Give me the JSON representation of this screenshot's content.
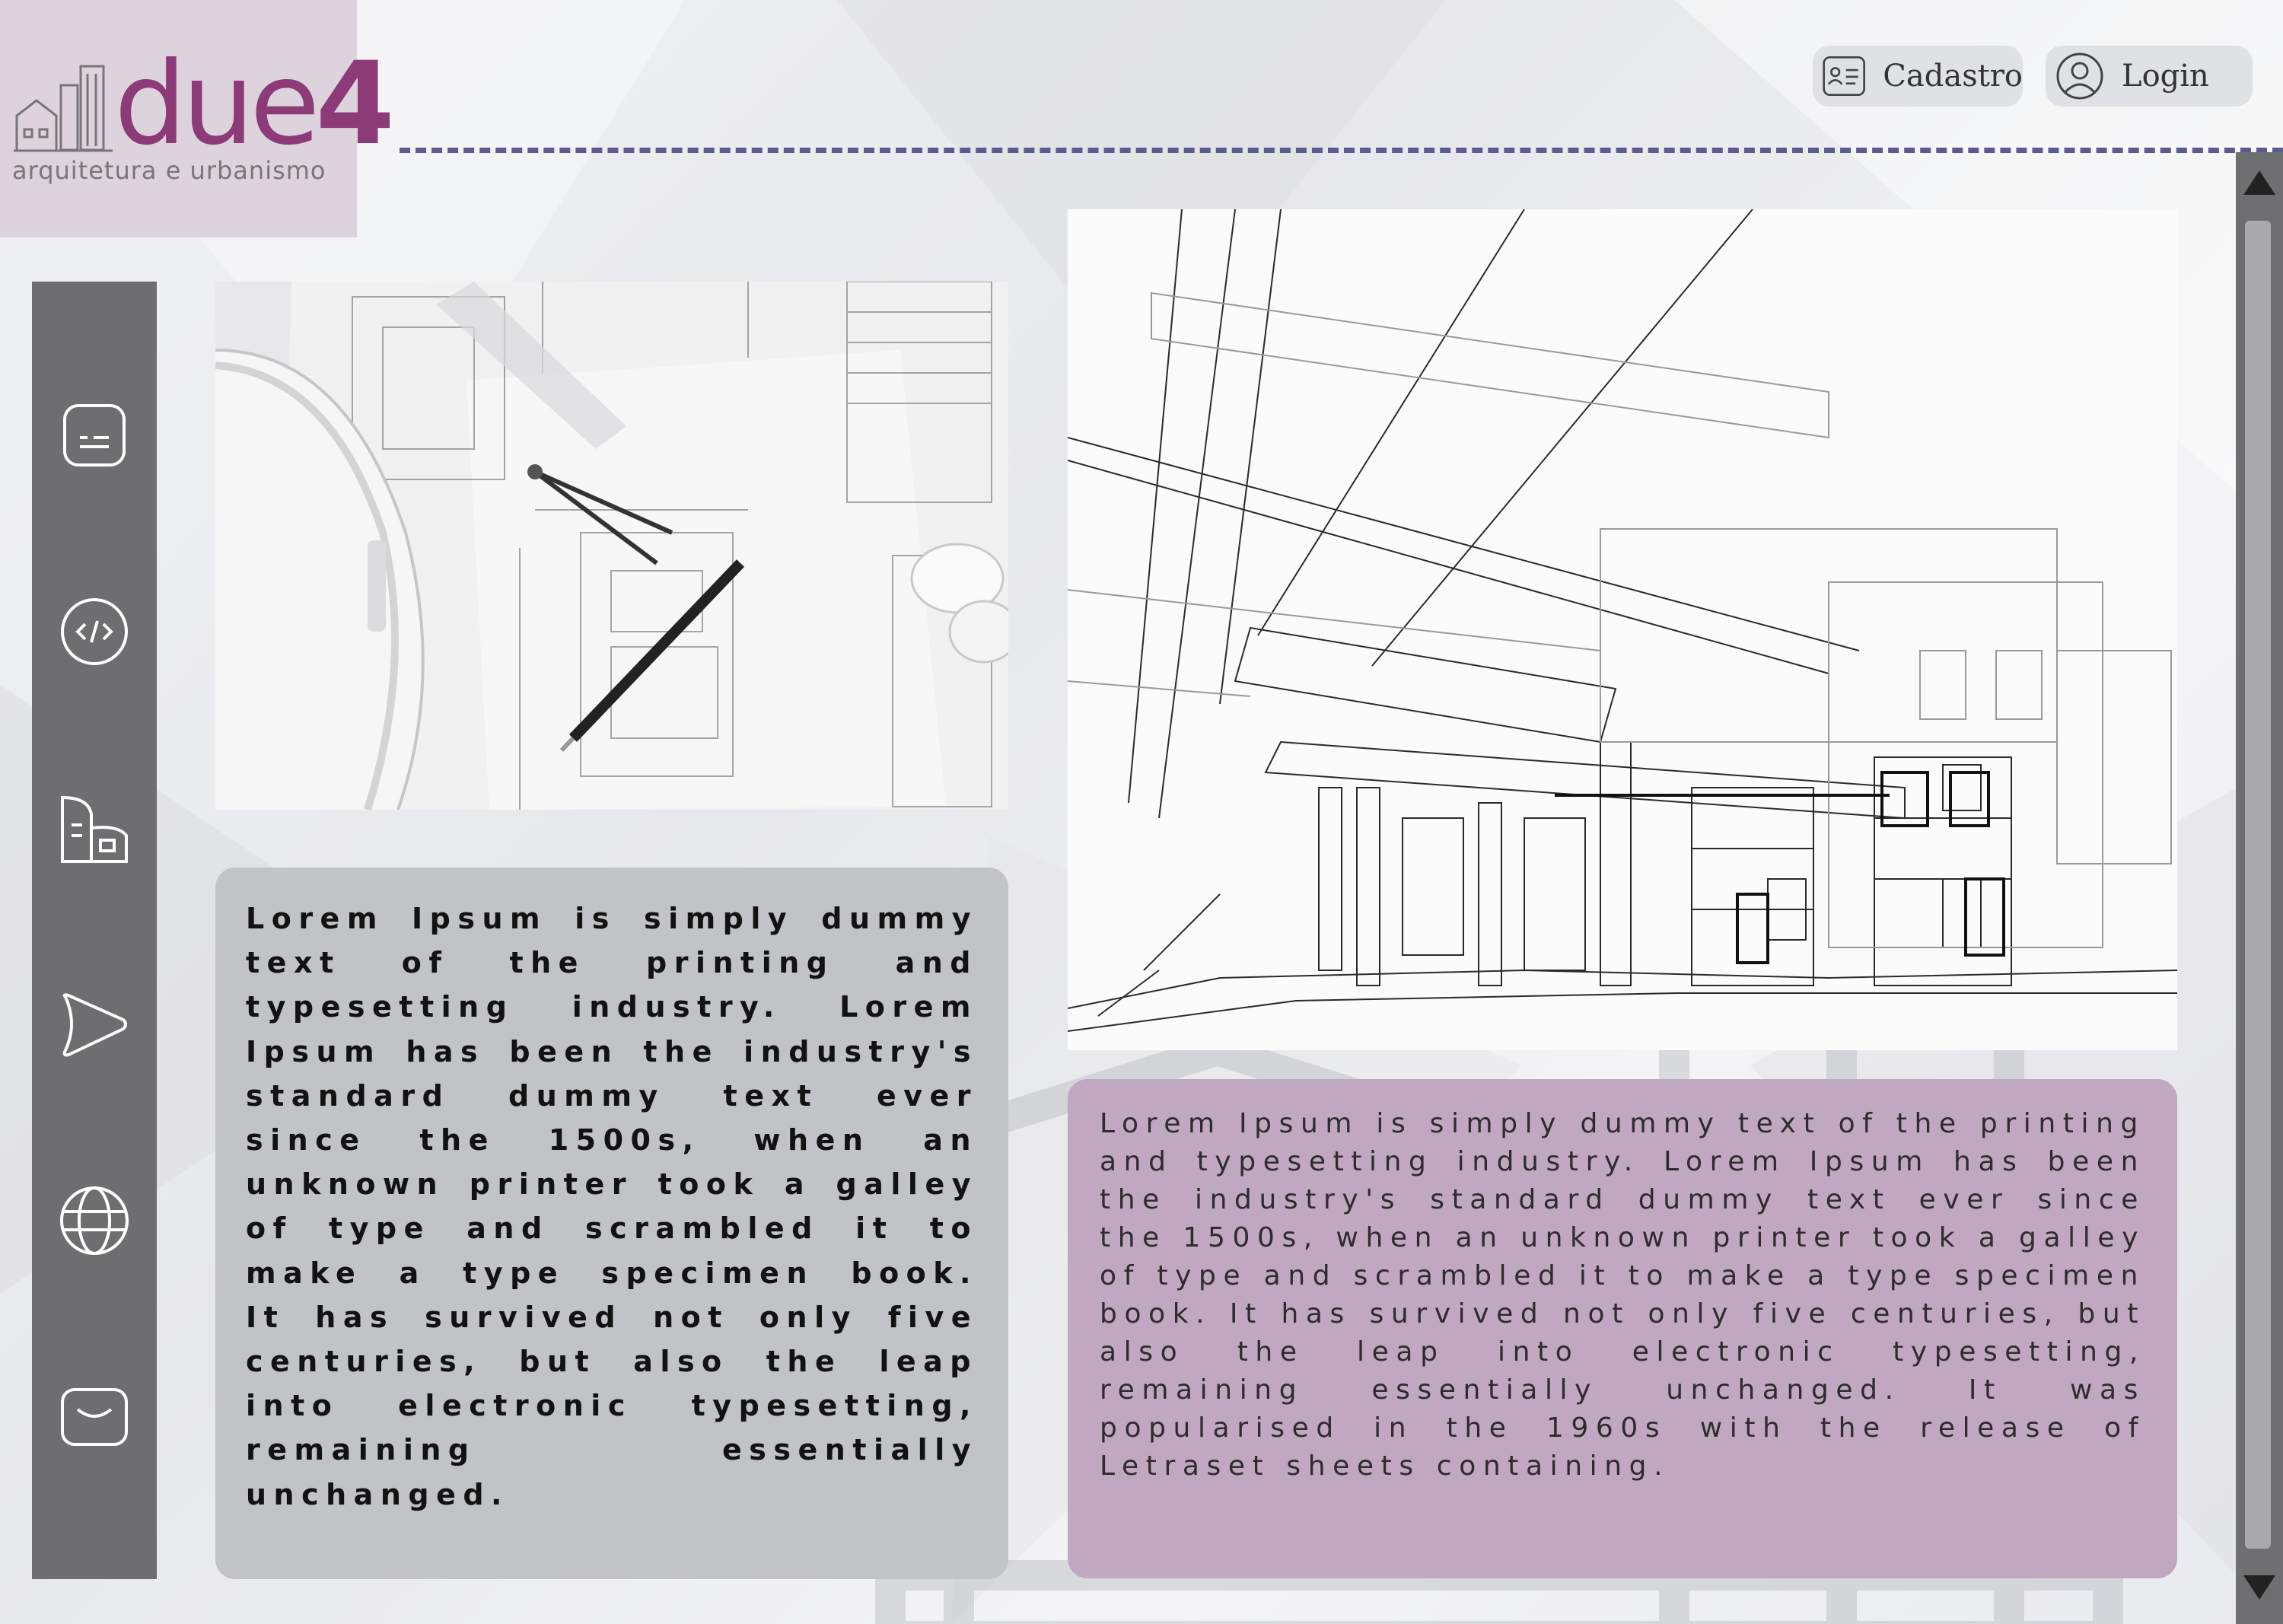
{
  "brand": {
    "name_light": "due",
    "name_bold": "4",
    "tagline": "arquitetura e urbanismo",
    "color": "#8c3a78"
  },
  "header": {
    "buttons": [
      {
        "label": "Cadastro",
        "icon": "id-card-icon"
      },
      {
        "label": "Login",
        "icon": "user-circle-icon"
      }
    ],
    "divider_color": "#5a5c8e"
  },
  "sidebar": {
    "items": [
      {
        "icon": "message-box-icon"
      },
      {
        "icon": "code-icon"
      },
      {
        "icon": "buildings-icon"
      },
      {
        "icon": "play-icon"
      },
      {
        "icon": "globe-icon"
      },
      {
        "icon": "mail-icon"
      }
    ]
  },
  "cards": {
    "gray_text": "Lorem Ipsum is simply dummy text of the printing and typesetting industry. Lorem Ipsum has been the industry's standard dummy text ever since the 1500s, when an unknown printer took a galley of type and scrambled it to make a type specimen book. It has survived not only five centuries, but also the leap into electronic typesetting, remaining essentially unchanged.",
    "purple_text": "Lorem Ipsum is simply dummy text of the printing and typesetting industry. Lorem Ipsum has been the industry's standard dummy text ever since the 1500s, when an unknown printer took a galley of type and scrambled it to make a type specimen book. It has survived not only five centuries, but also the leap into electronic typesetting, remaining essentially unchanged. It was popularised in the 1960s with the release of Letraset sheets containing."
  },
  "colors": {
    "sidebar": "#6e6e70",
    "gray_card": "#c2c3c6",
    "purple_card": "#c0a8c1"
  }
}
